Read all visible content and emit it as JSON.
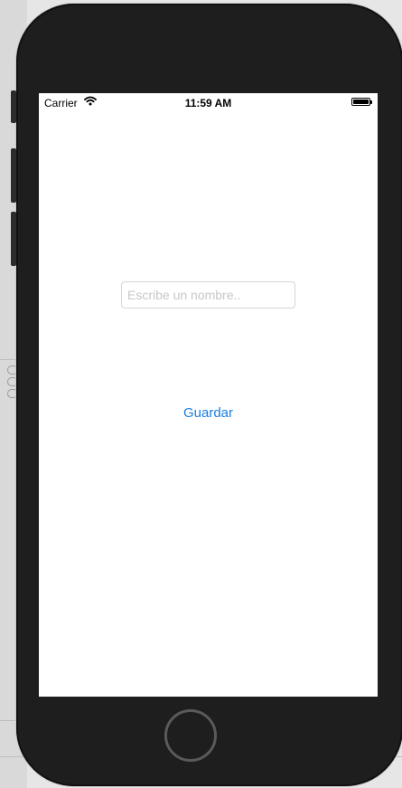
{
  "status_bar": {
    "carrier": "Carrier",
    "time": "11:59 AM",
    "wifi_icon": "wifi-icon",
    "battery_icon": "battery-full-icon"
  },
  "form": {
    "name_placeholder": "Escribe un nombre..",
    "name_value": ""
  },
  "actions": {
    "save_label": "Guardar",
    "accent_color": "#1a7ce0"
  },
  "device": {
    "home_button_icon": "home-button"
  }
}
